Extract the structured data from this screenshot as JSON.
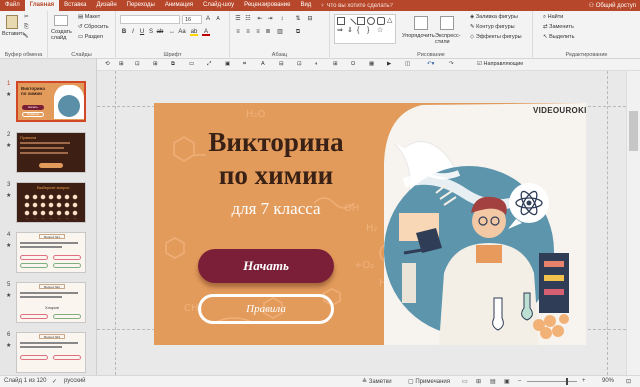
{
  "tabs": [
    "Файл",
    "Главная",
    "Вставка",
    "Дизайн",
    "Переходы",
    "Анимация",
    "Слайд-шоу",
    "Рецензирование",
    "Вид"
  ],
  "active_tab": "Главная",
  "tell_me": "Что вы хотите сделать?",
  "login": "Общий доступ",
  "ribbon": {
    "paste": "Вставить",
    "clipboard": "Буфер обмена",
    "new_slide": "Создать слайд",
    "layout": "Макет",
    "reset": "Сбросить",
    "section": "Раздел",
    "slides": "Слайды",
    "font_size": "16",
    "font": "Шрифт",
    "paragraph": "Абзац",
    "arrange": "Упорядочить",
    "quick_styles": "Экспресс-стили",
    "drawing": "Рисование",
    "fill": "Заливка фигуры",
    "outline": "Контур фигуры",
    "effects": "Эффекты фигуры",
    "find": "Найти",
    "replace": "Заменить",
    "select": "Выделить",
    "editing": "Редактирование"
  },
  "toolbar2": {
    "guides": "Направляющие"
  },
  "thumbnails": [
    {
      "num": "1",
      "title": "Викторина по химии",
      "btn1": "Начать",
      "btn2": "Правила"
    },
    {
      "num": "2",
      "title": "Правила"
    },
    {
      "num": "3",
      "title": "Выберите вопрос"
    },
    {
      "num": "4",
      "title": "Вопрос №1"
    },
    {
      "num": "5",
      "title": "Вопрос №2",
      "answer": "Хлорин"
    },
    {
      "num": "6",
      "title": "Вопрос №3"
    }
  ],
  "slide": {
    "title1": "Викторина",
    "title2": "по химии",
    "subtitle": "для 7 класса",
    "start_btn": "Начать",
    "rules_btn": "Правила",
    "logo": "VIDEOUROKI"
  },
  "status": {
    "slide_count": "Слайд 1 из 120",
    "language": "русский",
    "notes": "Заметки",
    "comments": "Примечания",
    "zoom": "90%"
  }
}
